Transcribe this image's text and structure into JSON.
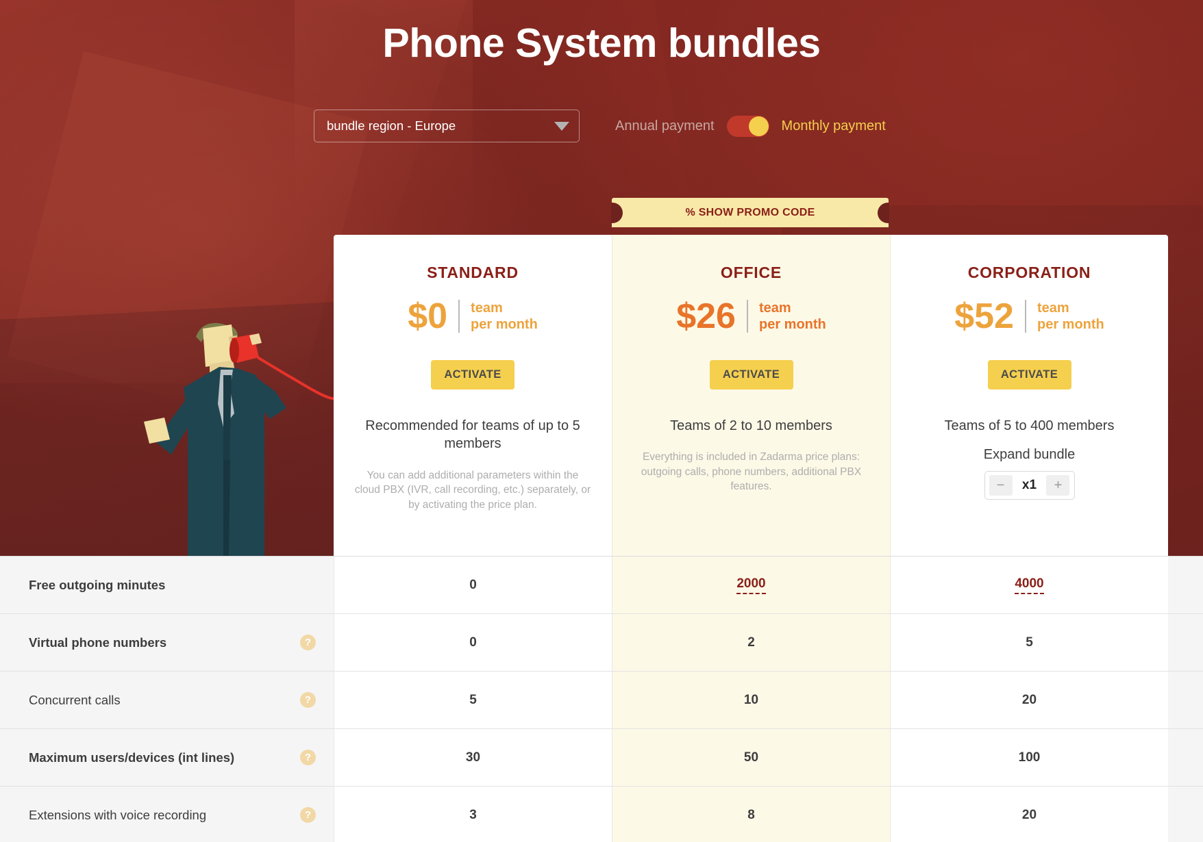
{
  "header": {
    "title": "Phone System bundles",
    "region_select": {
      "value": "bundle region - Europe",
      "caret_icon": "chevron-down-icon"
    },
    "payment": {
      "annual_label": "Annual payment",
      "monthly_label": "Monthly payment",
      "selected": "Monthly payment"
    }
  },
  "promo": {
    "label": "% SHOW PROMO CODE"
  },
  "plans": [
    {
      "name": "STANDARD",
      "price": "$0",
      "unit_line1": "team",
      "unit_line2": "per month",
      "cta": "ACTIVATE",
      "desc": "Recommended for teams of up to 5 members",
      "note": "You can add additional parameters within the cloud PBX (IVR, call recording, etc.) separately, or by activating the price plan.",
      "highlight": false
    },
    {
      "name": "OFFICE",
      "price": "$26",
      "unit_line1": "team",
      "unit_line2": "per month",
      "cta": "ACTIVATE",
      "desc": "Teams of 2 to 10 members",
      "note": "Everything is included in Zadarma price plans: outgoing calls, phone numbers, additional PBX features.",
      "highlight": true
    },
    {
      "name": "CORPORATION",
      "price": "$52",
      "unit_line1": "team",
      "unit_line2": "per month",
      "cta": "ACTIVATE",
      "desc": "Teams of 5 to 400 members",
      "expand_label": "Expand bundle",
      "stepper": {
        "minus": "−",
        "value": "x1",
        "plus": "+"
      },
      "highlight": false
    }
  ],
  "features": [
    {
      "label": "Free outgoing minutes",
      "bold": true,
      "help": false,
      "values": [
        {
          "text": "0",
          "tooltip": false
        },
        {
          "text": "2000",
          "tooltip": true
        },
        {
          "text": "4000",
          "tooltip": true
        }
      ]
    },
    {
      "label": "Virtual phone numbers",
      "bold": true,
      "help": true,
      "help_icon": "question-mark-icon",
      "values": [
        {
          "text": "0",
          "tooltip": false
        },
        {
          "text": "2",
          "tooltip": false
        },
        {
          "text": "5",
          "tooltip": false
        }
      ]
    },
    {
      "label": "Concurrent calls",
      "bold": false,
      "help": true,
      "help_icon": "question-mark-icon",
      "values": [
        {
          "text": "5",
          "tooltip": false
        },
        {
          "text": "10",
          "tooltip": false
        },
        {
          "text": "20",
          "tooltip": false
        }
      ]
    },
    {
      "label": "Maximum users/devices (int lines)",
      "bold": true,
      "help": true,
      "help_icon": "question-mark-icon",
      "values": [
        {
          "text": "30",
          "tooltip": false
        },
        {
          "text": "50",
          "tooltip": false
        },
        {
          "text": "100",
          "tooltip": false
        }
      ]
    },
    {
      "label": "Extensions with voice recording",
      "bold": false,
      "help": true,
      "help_icon": "question-mark-icon",
      "values": [
        {
          "text": "3",
          "tooltip": false
        },
        {
          "text": "8",
          "tooltip": false
        },
        {
          "text": "20",
          "tooltip": false
        }
      ]
    }
  ],
  "colors": {
    "brand_red": "#8a2018",
    "hero_red": "#7e2721",
    "accent_yellow": "#f5cf4e",
    "price_orange": "#eda33c",
    "price_orange_dark": "#e8742a",
    "highlight_cream": "#fdf9e7",
    "promo_cream": "#f8e9a8"
  }
}
